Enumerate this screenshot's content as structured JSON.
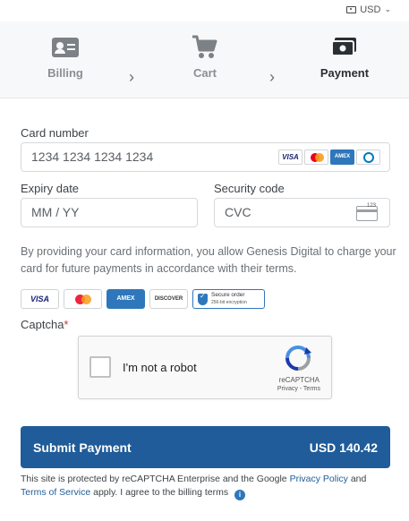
{
  "currency": {
    "label": "USD"
  },
  "steps": [
    {
      "label": "Billing",
      "state": "inactive",
      "icon": "id-card-icon"
    },
    {
      "label": "Cart",
      "state": "inactive",
      "icon": "cart-icon"
    },
    {
      "label": "Payment",
      "state": "active",
      "icon": "payment-icon"
    }
  ],
  "form": {
    "card_number": {
      "label": "Card number",
      "placeholder": "1234 1234 1234 1234",
      "brands": [
        "VISA",
        "Mastercard",
        "AMEX",
        "Diners"
      ]
    },
    "expiry": {
      "label": "Expiry date",
      "placeholder": "MM / YY"
    },
    "security": {
      "label": "Security code",
      "placeholder": "CVC",
      "icon_text": "123"
    }
  },
  "consent_text": "By providing your card information, you allow Genesis Digital to charge your card for future payments in accordance with their terms.",
  "badges": {
    "visa": "VISA",
    "amex": "AMEX",
    "discover": "DISCOVER",
    "secure_title": "Secure order",
    "secure_sub": "256-bit encryption"
  },
  "captcha": {
    "label": "Captcha",
    "required_mark": "*",
    "checkbox_text": "I'm not a robot",
    "brand": "reCAPTCHA",
    "links": "Privacy - Terms"
  },
  "submit": {
    "label": "Submit Payment",
    "amount": "USD 140.42"
  },
  "legal": {
    "prefix": "This site is protected by reCAPTCHA Enterprise and the Google",
    "privacy": "Privacy Policy",
    "and": "and",
    "terms": "Terms of Service",
    "suffix": "apply. I agree to the billing terms",
    "info_icon": "i"
  },
  "colors": {
    "accent": "#1f5c99",
    "amex": "#2e77bb",
    "required": "#d93025"
  }
}
